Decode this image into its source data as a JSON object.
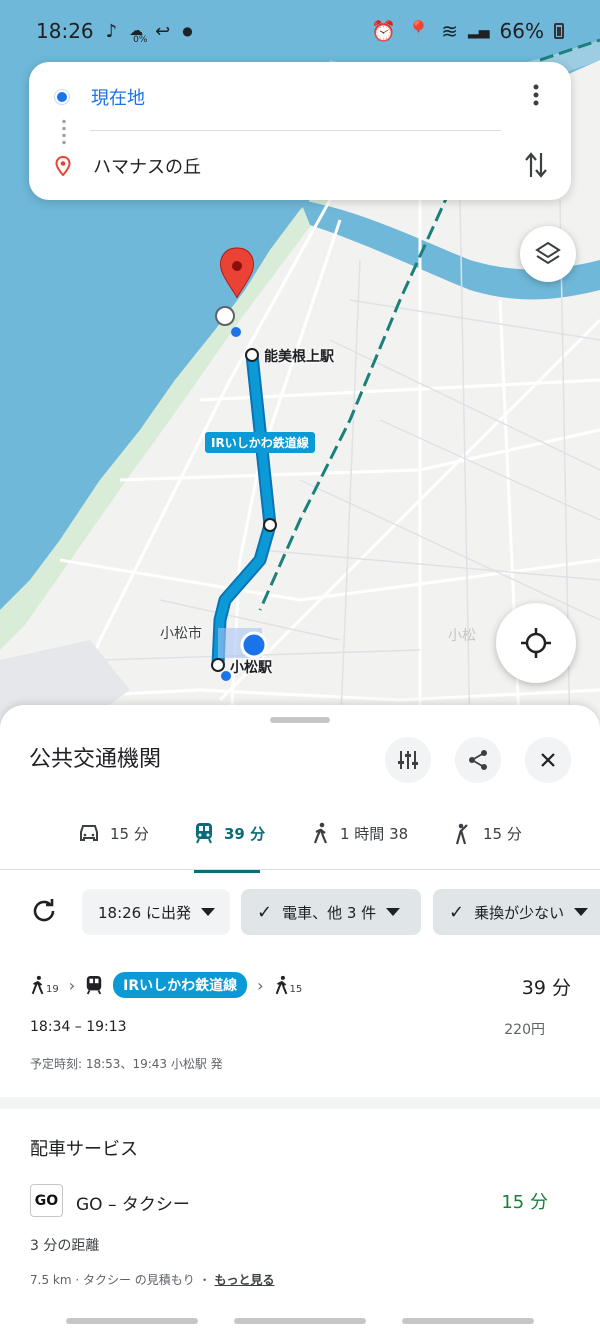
{
  "status_bar": {
    "time": "18:26",
    "left_icons": [
      "tiktok-icon",
      "weather-icon",
      "reply-icon",
      "dot-icon"
    ],
    "weather_pct": "0%",
    "battery": "66%"
  },
  "search": {
    "origin": "現在地",
    "destination": "ハマナスの丘"
  },
  "map": {
    "labels": {
      "station_top": "能美根上駅",
      "line_name": "IRいしかわ鉄道線",
      "city": "小松市",
      "station_bottom": "小松駅",
      "faint": "小松"
    },
    "colors": {
      "sea": "#6fb8d9",
      "route": "#0b9ad6",
      "pin": "#ea4335"
    }
  },
  "sheet": {
    "title": "公共交通機関",
    "modes": [
      {
        "icon": "car-icon",
        "label": "15 分"
      },
      {
        "icon": "train-icon",
        "label": "39 分",
        "active": true
      },
      {
        "icon": "walk-icon",
        "label": "1 時間 38"
      },
      {
        "icon": "ride-icon",
        "label": "15 分"
      }
    ],
    "chips": {
      "depart": "18:26 に出発",
      "modes": "電車、他 3 件",
      "fewer_transfers": "乗換が少ない"
    },
    "route": {
      "walk1": "19",
      "line": "IRいしかわ鉄道線",
      "walk2": "15",
      "duration": "39 分",
      "times": "18:34 – 19:13",
      "fare": "220円",
      "note": "予定時刻: 18:53、19:43 小松駅 発"
    },
    "ride": {
      "title": "配車サービス",
      "logo": "GO",
      "name": "GO – タクシー",
      "time": "15 分",
      "distance": "3 分の距離",
      "estimate": "7.5 km · タクシー の見積もり ・",
      "more": "もっと見る"
    }
  }
}
